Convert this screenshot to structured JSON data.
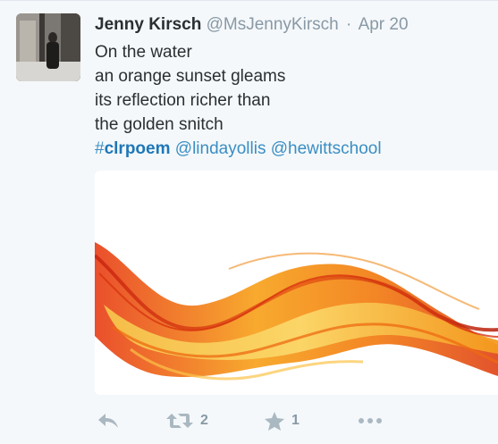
{
  "tweet": {
    "author": {
      "fullname": "Jenny Kirsch",
      "username": "@MsJennyKirsch",
      "separator": "·",
      "time": "Apr 20"
    },
    "text_lines": [
      "On the water",
      "an orange sunset gleams",
      "its reflection richer than",
      "the golden snitch"
    ],
    "hashtag": {
      "symbol": "#",
      "text": "clrpoem"
    },
    "mentions": [
      "@lindayollis",
      "@hewittschool"
    ],
    "actions": {
      "retweet_count": "2",
      "favorite_count": "1"
    },
    "icons": {
      "reply": "reply-icon",
      "retweet": "retweet-icon",
      "favorite": "star-icon",
      "more": "more-dots-icon"
    },
    "colors": {
      "link": "#3a8ec4",
      "hashtag": "#1f77b7",
      "muted": "#8899a6",
      "action_icon": "#aab8c2",
      "text": "#292f33",
      "background": "#f5f8fa"
    }
  }
}
